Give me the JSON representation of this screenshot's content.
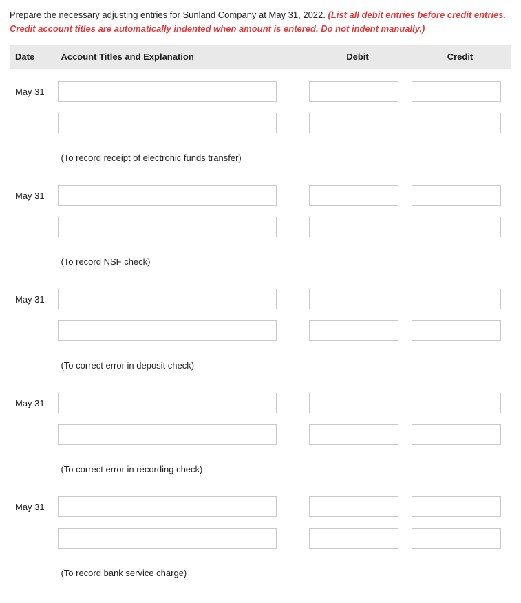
{
  "instructions": {
    "black": "Prepare the necessary adjusting entries for Sunland Company at May 31, 2022. ",
    "red": "(List all debit entries before credit entries. Credit account titles are automatically indented when amount is entered. Do not indent manually.)"
  },
  "headers": {
    "date": "Date",
    "account": "Account Titles and Explanation",
    "debit": "Debit",
    "credit": "Credit"
  },
  "entries": [
    {
      "date": "May 31",
      "note": "(To record receipt of electronic funds transfer)"
    },
    {
      "date": "May 31",
      "note": "(To record NSF check)"
    },
    {
      "date": "May 31",
      "note": "(To correct error in deposit check)"
    },
    {
      "date": "May 31",
      "note": "(To correct error in recording check)"
    },
    {
      "date": "May 31",
      "note": "(To record bank service charge)"
    }
  ]
}
